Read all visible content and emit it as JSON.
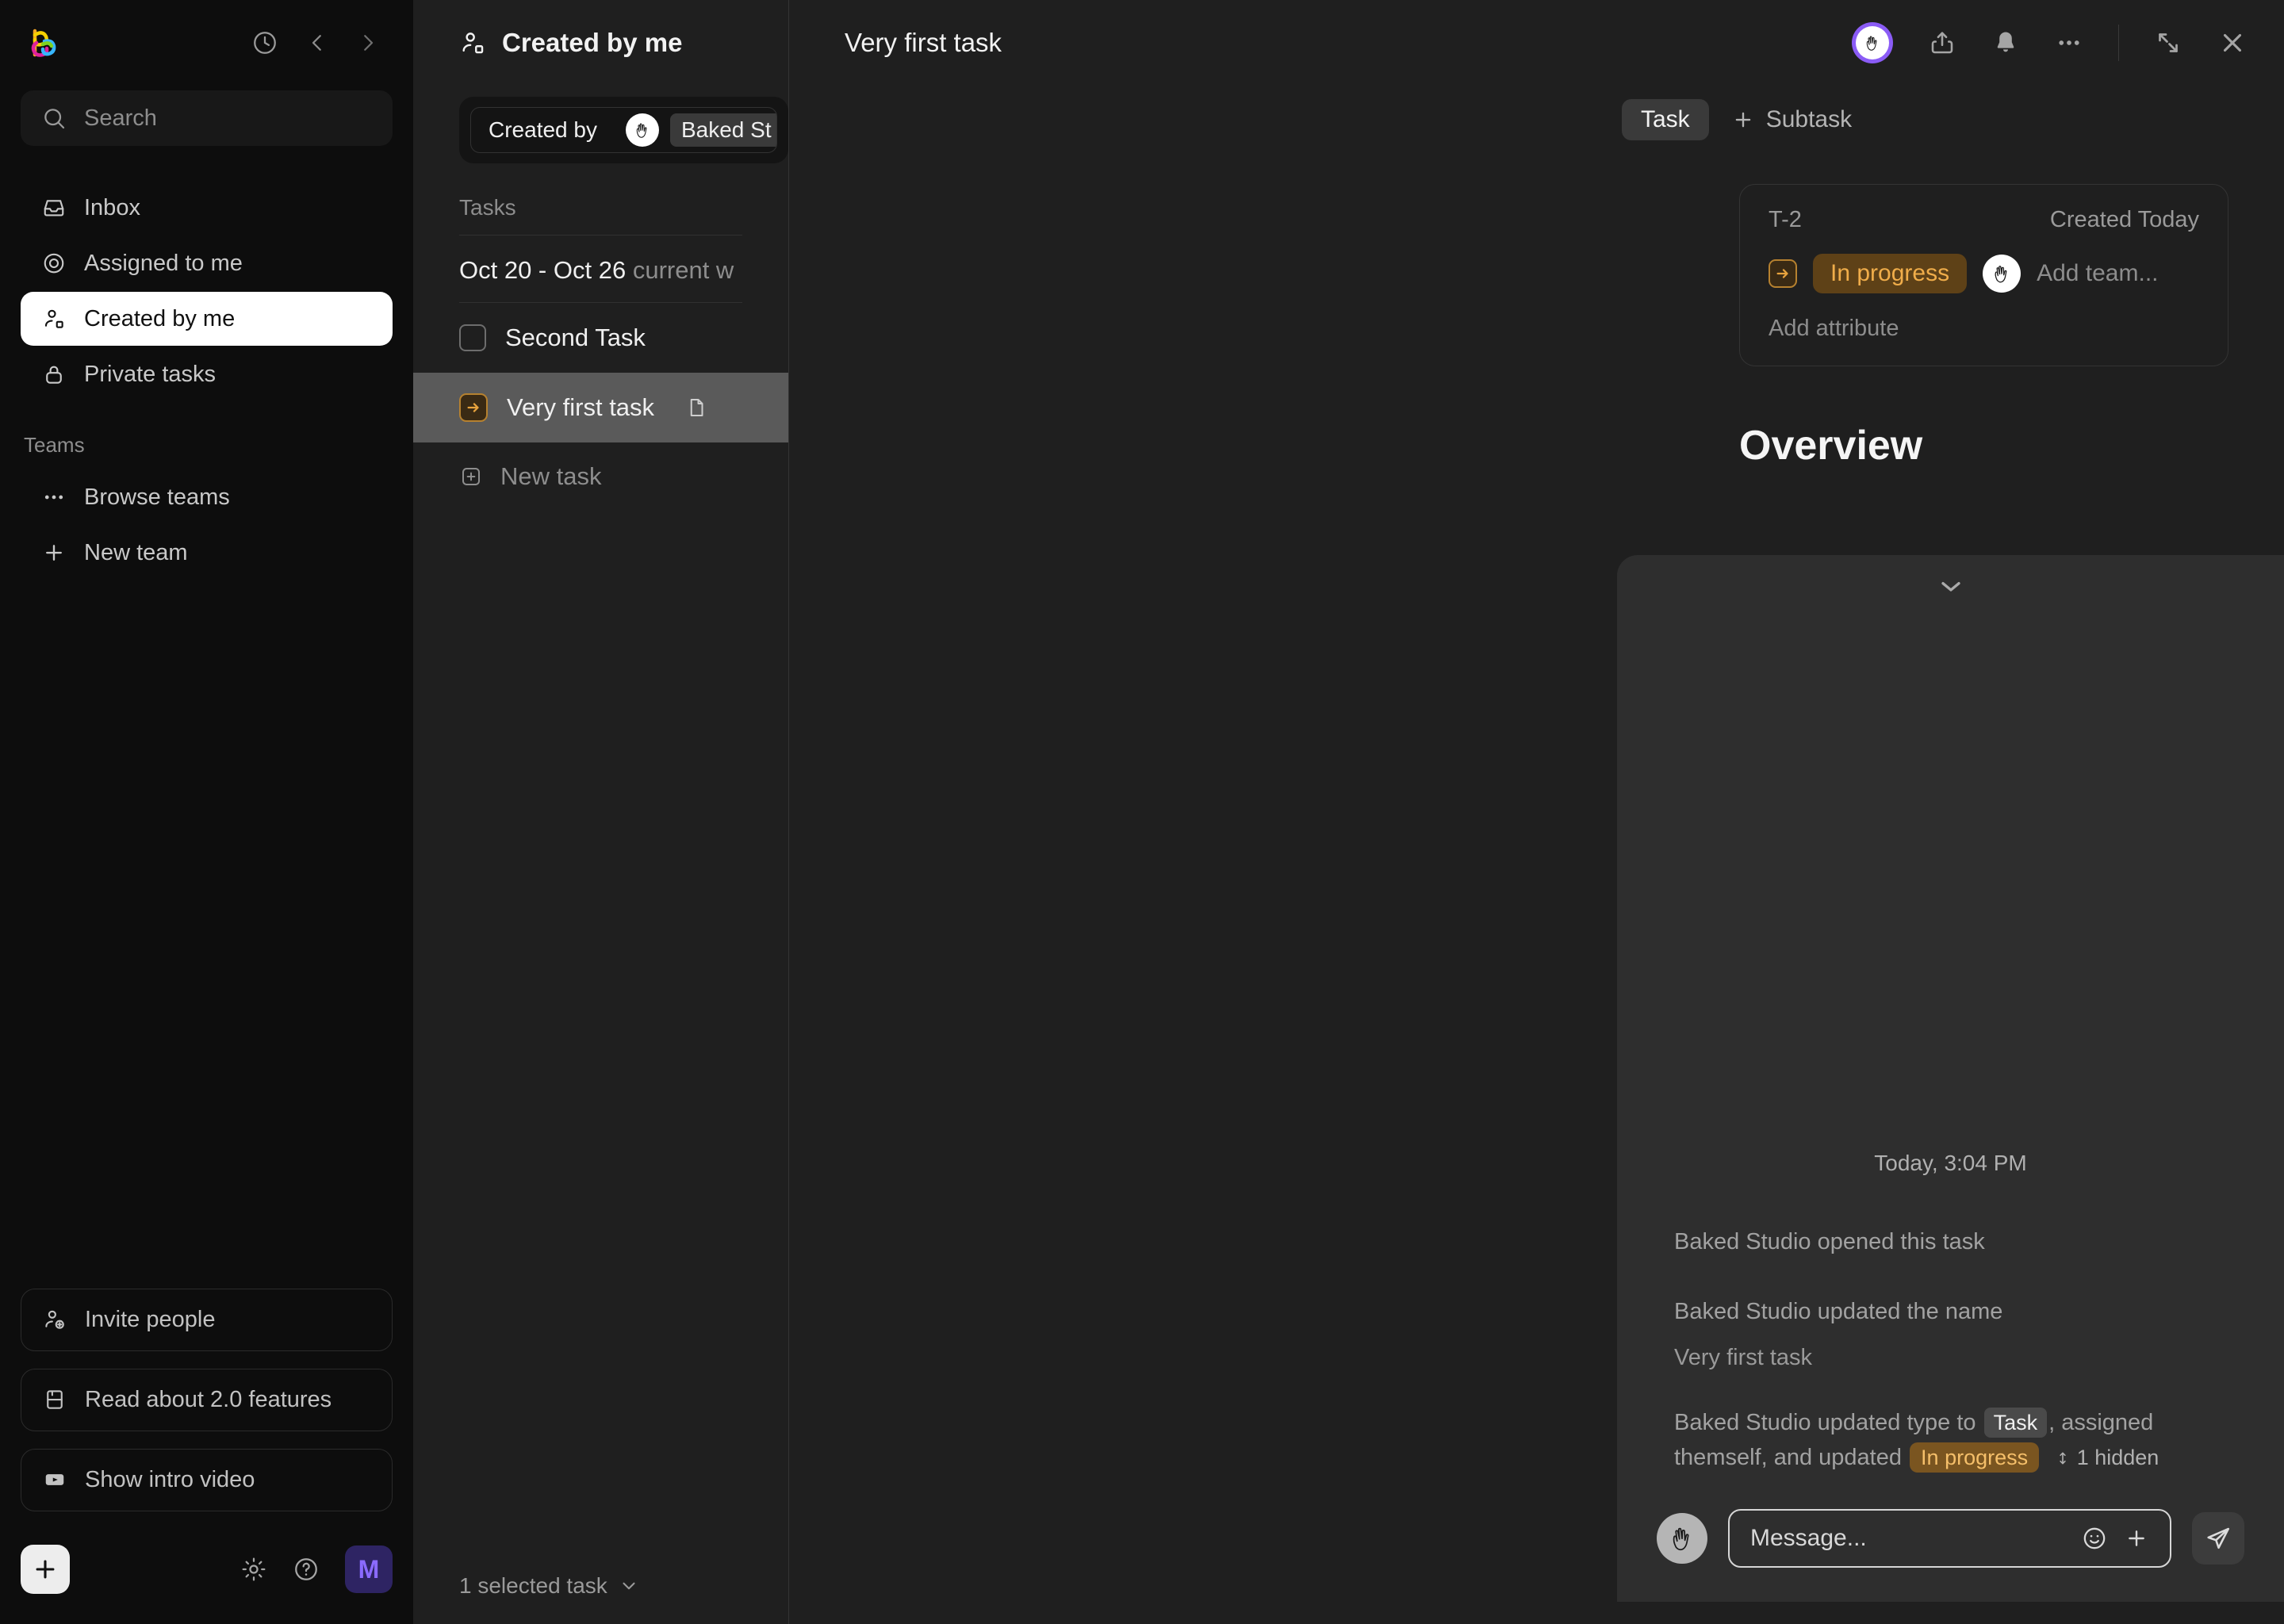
{
  "sidebar": {
    "search": {
      "placeholder": "Search"
    },
    "top_icons": [
      {
        "name": "history-icon",
        "label": "History"
      },
      {
        "name": "chevron-left-icon",
        "label": "Back"
      },
      {
        "name": "chevron-right-icon",
        "label": "Forward"
      }
    ],
    "nav": [
      {
        "label": "Inbox",
        "icon": "inbox-icon",
        "active": false
      },
      {
        "label": "Assigned to me",
        "icon": "target-icon",
        "active": false
      },
      {
        "label": "Created by me",
        "icon": "user-square-icon",
        "active": true
      },
      {
        "label": "Private tasks",
        "icon": "lock-icon",
        "active": false
      }
    ],
    "teams_label": "Teams",
    "teams": [
      {
        "label": "Browse teams",
        "icon": "ellipsis-icon"
      },
      {
        "label": "New team",
        "icon": "plus-icon"
      }
    ],
    "cards": [
      {
        "label": "Invite people",
        "icon": "user-plus-icon"
      },
      {
        "label": "Read about 2.0 features",
        "icon": "book-icon"
      },
      {
        "label": "Show intro video",
        "icon": "video-icon"
      }
    ],
    "bottom": {
      "add_label": "+",
      "settings_icon": "gear-icon",
      "help_icon": "help-circle-icon",
      "avatar_initial": "M"
    }
  },
  "list_panel": {
    "title": "Created by me",
    "filter": {
      "label": "Created by",
      "value": "Baked St"
    },
    "section_label": "Tasks",
    "week_range": "Oct 20 - Oct 26",
    "week_suffix": "current w",
    "tasks": [
      {
        "name": "Second Task",
        "selected": false,
        "type": "checkbox",
        "has_doc": false
      },
      {
        "name": "Very first task",
        "selected": true,
        "type": "in-progress",
        "has_doc": true
      }
    ],
    "new_task_label": "New task",
    "footer": "1 selected task"
  },
  "detail": {
    "title": "Very first task",
    "header_icons": [
      {
        "name": "share-icon"
      },
      {
        "name": "bell-icon"
      },
      {
        "name": "more-horizontal-icon"
      },
      {
        "name": "expand-icon"
      },
      {
        "name": "close-icon"
      }
    ],
    "tabs": {
      "active_tab": "Task",
      "subtask_label": "Subtask"
    },
    "attributes": {
      "id": "T-2",
      "created": "Created Today",
      "status": "In progress",
      "add_team_placeholder": "Add team...",
      "add_attribute": "Add attribute"
    },
    "overview_heading": "Overview",
    "conversation": {
      "timestamp": "Today, 3:04 PM",
      "events": [
        {
          "text": "Baked Studio opened this task"
        },
        {
          "text": "Baked Studio updated the name",
          "sub": "Very first task"
        }
      ],
      "last_event": {
        "prefix": "Baked Studio updated type to",
        "type_pill": "Task",
        "middle": ", assigned themself, and updated",
        "status_pill": "In progress",
        "hidden": "1 hidden"
      }
    },
    "composer": {
      "placeholder": "Message...",
      "emoji_icon": "emoji-icon",
      "attach_icon": "plus-icon",
      "send_icon": "send-icon"
    }
  },
  "colors": {
    "sidebar_bg": "#0d0d0d",
    "panel_bg": "#1f1f1f",
    "conversation_bg": "#2e2e2e",
    "accent_purple": "#8b5cf6",
    "status_orange": "#f0ad4a",
    "selected_row": "#5a5a5a"
  }
}
